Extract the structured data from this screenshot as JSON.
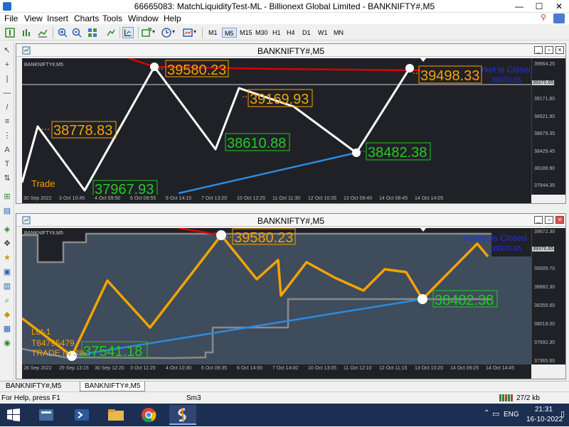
{
  "window": {
    "title": "66665083: MatchLiquidityTest-ML - Billionext Global Limited - BANKNIFTY#,M5",
    "min": "—",
    "max": "☐",
    "close": "✕"
  },
  "menu": [
    "File",
    "View",
    "Insert",
    "Charts",
    "Tools",
    "Window",
    "Help"
  ],
  "timeframes": [
    "M1",
    "M5",
    "M15",
    "M30",
    "H1",
    "H4",
    "D1",
    "W1",
    "MN"
  ],
  "active_timeframe": "M5",
  "chart1": {
    "caption": "BANKNIFTY#,M5",
    "symbol_label": "BANKNIFTY#,M5",
    "price_ticks": [
      "39664.25",
      "39370.65",
      "39171.80",
      "38921.90",
      "38679.35",
      "38429.45",
      "38186.90",
      "37944.35"
    ],
    "current_price": "39370.65",
    "time_ticks": [
      "30 Sep 2022",
      "3 Oct 10:45",
      "4 Oct 09:50",
      "6 Oct 08:55",
      "6 Oct 14:15",
      "7 Oct 13:20",
      "10 Oct 12:25",
      "11 Oct 11:30",
      "12 Oct 10:35",
      "13 Oct 09:40",
      "14 Oct 08:45",
      "14 Oct 14:05"
    ],
    "labels": {
      "a": "39580.23",
      "b": "39498.33",
      "c": "39169.93",
      "d": "38778.83",
      "e": "38610.88",
      "f": "38482.38",
      "g": "37967.93"
    },
    "market_text": "rket is Closed",
    "countdown": "39370.65",
    "trade_label": "Trade"
  },
  "chart2": {
    "caption": "BANKNIFTY#,M5",
    "symbol_label": "BANKNIFTY#,M5",
    "price_ticks": [
      "39672.30",
      "39370.65",
      "39009.70",
      "38682.30",
      "38355.60",
      "38019.00",
      "37692.30",
      "37365.60"
    ],
    "current_price": "39370.65",
    "time_ticks": [
      "28 Sep 2022",
      "29 Sep 13:15",
      "30 Sep 12:20",
      "3 Oct 11:25",
      "4 Oct 10:30",
      "6 Oct 09:35",
      "6 Oct 14:55",
      "7 Oct 14:00",
      "10 Oct 13:05",
      "11 Oct 12:10",
      "12 Oct 11:15",
      "13 Oct 10:20",
      "14 Oct 09:25",
      "14 Oct 14:45"
    ],
    "labels": {
      "a": "39580.23",
      "f": "38482.38",
      "g": "37541.18"
    },
    "market_text": "Market is Closed",
    "countdown": "39370.65",
    "info": [
      "Lot-1",
      "T64795479",
      "TRADE IN 3%"
    ]
  },
  "tabs": [
    "BANKNIFTY#,M5",
    "BANKNIFTY#,M5"
  ],
  "status": {
    "help": "For Help, press F1",
    "profile": "Sm3",
    "traffic": "27/2 kb"
  },
  "taskbar": {
    "lang": "ENG",
    "time": "21:31",
    "date": "16-10-2022"
  },
  "colors": {
    "chart_bg": "#1f2126",
    "white_line": "#ffffff",
    "red_line": "#dd0000",
    "blue_line": "#2b8ae0",
    "orange_line": "#f5a300",
    "label_orange": "#f5a300",
    "label_green": "#22cc22"
  }
}
